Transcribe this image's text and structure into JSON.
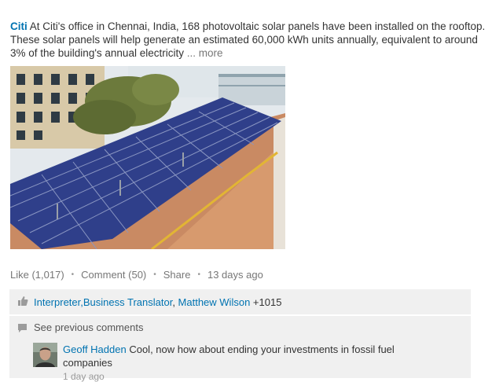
{
  "post": {
    "author": "Citi",
    "body": " At Citi's office in Chennai, India, 168 photovoltaic solar panels have been installed on the rooftop. These solar panels will help generate an estimated 60,000 kWh units annually, equivalent to around 3% of the building's annual electricity",
    "ellipsis": " ... ",
    "more_label": "more"
  },
  "actions": {
    "like_label": "Like (1,017)",
    "comment_label": "Comment (50)",
    "share_label": "Share",
    "timestamp": "13 days ago",
    "separator": "•"
  },
  "likes": {
    "liker1": "Interpreter,Business Translator",
    "separator": ", ",
    "liker2": "Matthew Wilson",
    "others": " +1015"
  },
  "comments": {
    "see_previous_label": "See previous comments",
    "items": [
      {
        "author": "Geoff Hadden",
        "text": " Cool, now how about ending your investments in fossil fuel companies",
        "time": "1 day ago"
      }
    ]
  },
  "icons": {
    "thumb": "thumbs-up-icon",
    "bubble": "comment-bubble-icon"
  }
}
